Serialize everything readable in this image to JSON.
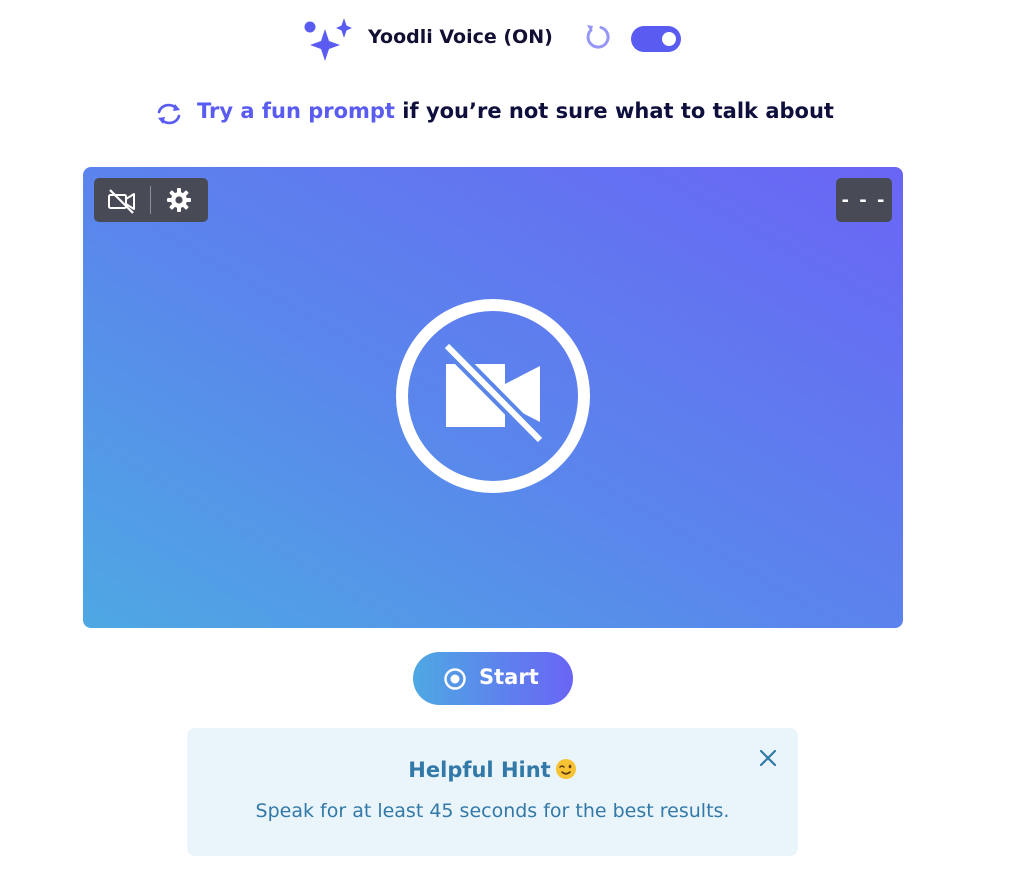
{
  "voice": {
    "label": "Yoodli Voice (ON)",
    "toggle_on": true,
    "accent": "#5a5bf0",
    "icons": {
      "sparkle": "sparkles-icon",
      "reset": "reset-icon"
    }
  },
  "prompt": {
    "link_text": "Try a fun prompt",
    "rest_text": " if you’re not sure what to talk about",
    "icon": "refresh-icon"
  },
  "camera": {
    "timer": "- - -",
    "colors": {
      "from": "#4ea8e3",
      "to": "#6a65f5"
    },
    "icons": {
      "camera_off": "camera-off-icon",
      "settings": "gear-icon",
      "big": "camera-off-circle-icon"
    }
  },
  "start_button": {
    "label": "Start",
    "icon": "record-icon"
  },
  "hint": {
    "title": "Helpful Hint",
    "emoji_icon": "winking-face-icon",
    "body": "Speak for at least 45 seconds for the best results.",
    "close_icon": "close-icon"
  }
}
